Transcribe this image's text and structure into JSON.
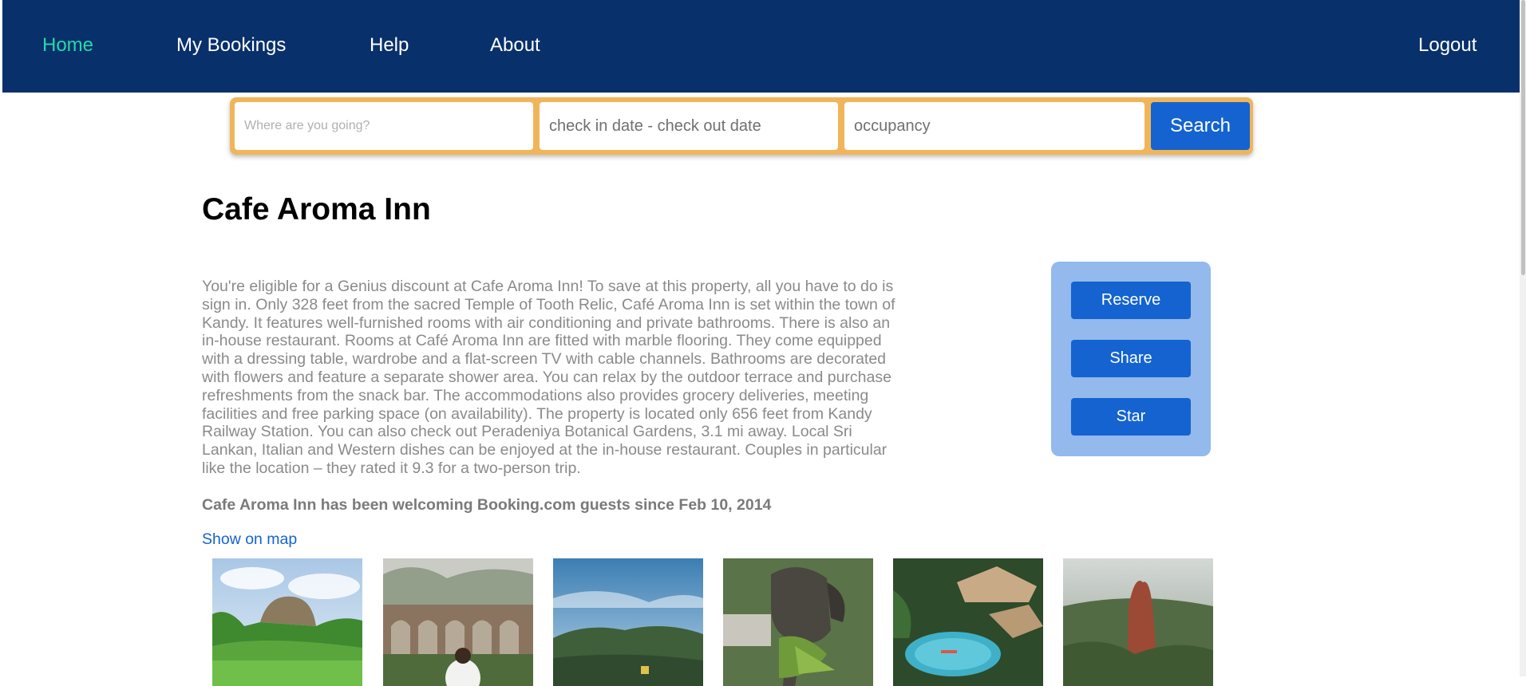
{
  "nav": {
    "home": "Home",
    "bookings": "My Bookings",
    "help": "Help",
    "about": "About",
    "logout": "Logout",
    "active_color": "#25d9a8",
    "bg_color": "#08306b"
  },
  "search": {
    "destination_placeholder": "Where are you going?",
    "dates_placeholder": "check in date - check out date",
    "occupancy_placeholder": "occupancy",
    "button_label": "Search",
    "frame_color": "#f0b55a"
  },
  "hotel": {
    "name": "Cafe Aroma Inn",
    "description": "You're eligible for a Genius discount at Cafe Aroma Inn! To save at this property, all you have to do is sign in. Only 328 feet from the sacred Temple of Tooth Relic, Café Aroma Inn is set within the town of Kandy. It features well-furnished rooms with air conditioning and private bathrooms. There is also an in-house restaurant. Rooms at Café Aroma Inn are fitted with marble flooring. They come equipped with a dressing table, wardrobe and a flat-screen TV with cable channels. Bathrooms are decorated with flowers and feature a separate shower area. You can relax by the outdoor terrace and purchase refreshments from the snack bar. The accommodations also provides grocery deliveries, meeting facilities and free parking space (on availability). The property is located only 656 feet from Kandy Railway Station. You can also check out Peradeniya Botanical Gardens, 3.1 mi away. Local Sri Lankan, Italian and Western dishes can be enjoyed at the in-house restaurant. Couples in particular like the location – they rated it 9.3 for a two-person trip.",
    "since": "Cafe Aroma Inn has been welcoming Booking.com guests since Feb 10, 2014",
    "map_link": "Show on map"
  },
  "actions": {
    "reserve": "Reserve",
    "share": "Share",
    "star": "Star",
    "panel_color": "#94b9ec",
    "button_color": "#1463d0"
  },
  "gallery": [
    {
      "name": "sigiriya-rock-photo"
    },
    {
      "name": "nine-arch-bridge-photo"
    },
    {
      "name": "kandy-lake-view-photo"
    },
    {
      "name": "elephant-photo"
    },
    {
      "name": "pool-villa-photo"
    },
    {
      "name": "rock-peak-jungle-photo"
    }
  ]
}
